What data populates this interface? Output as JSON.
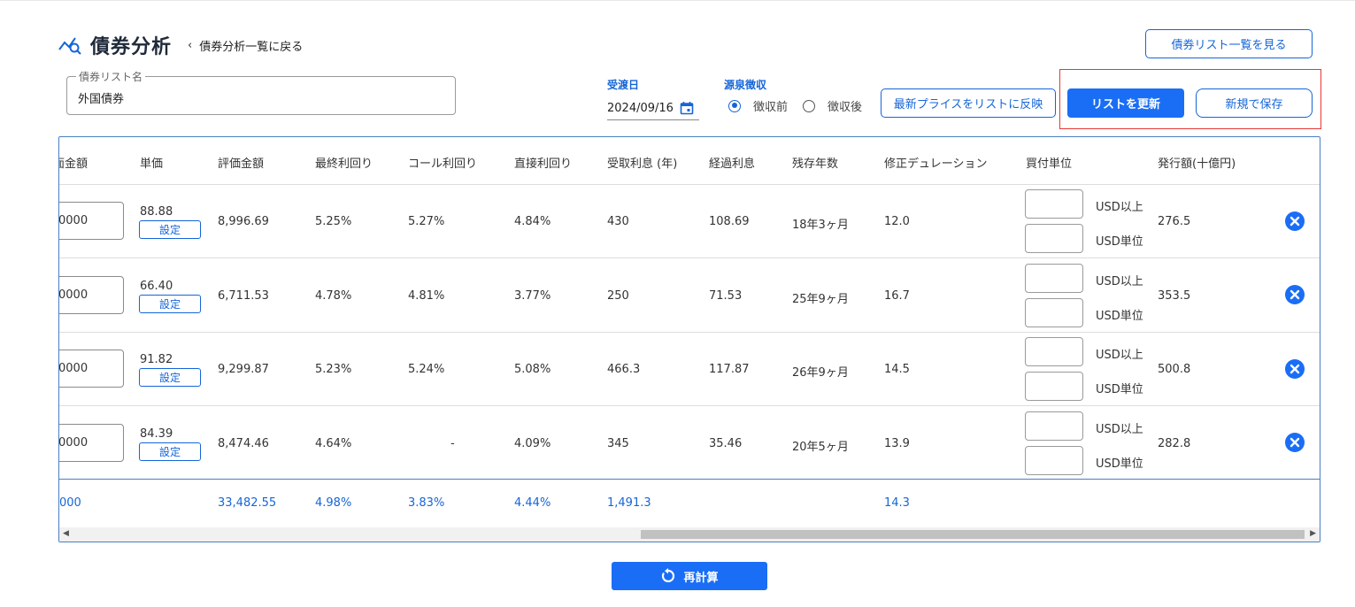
{
  "header": {
    "title": "債券分析",
    "back_link": "債券分析一覧に戻る",
    "view_list_button": "債券リスト一覧を見る"
  },
  "form": {
    "list_name_label": "債券リスト名",
    "list_name_value": "外国債券",
    "settlement_label": "受渡日",
    "settlement_date": "2024/09/16",
    "withholding_label": "源泉徴収",
    "withholding_options": [
      "徴収前",
      "徴収後"
    ],
    "withholding_selected": "徴収前",
    "reflect_price_button": "最新プライスをリストに反映",
    "update_list_button": "リストを更新",
    "save_new_button": "新規で保存"
  },
  "table": {
    "headers": [
      "面金額",
      "単価",
      "評価金額",
      "最終利回り",
      "コール利回り",
      "直接利回り",
      "受取利息 (年)",
      "経過利息",
      "残存年数",
      "修正デュレーション",
      "買付単位",
      "発行額(十億円)"
    ],
    "set_label": "設定",
    "unit_labels": [
      "USD以上",
      "USD単位"
    ],
    "rows": [
      {
        "face": "0000",
        "price": "88.88",
        "valuation": "8,996.69",
        "ytm": "5.25%",
        "ytc": "5.27%",
        "current_yield": "4.84%",
        "annual_interest": "430",
        "accrued": "108.69",
        "remaining": "18年3ヶ月",
        "mod_duration": "12.0",
        "issue": "276.5"
      },
      {
        "face": "0000",
        "price": "66.40",
        "valuation": "6,711.53",
        "ytm": "4.78%",
        "ytc": "4.81%",
        "current_yield": "3.77%",
        "annual_interest": "250",
        "accrued": "71.53",
        "remaining": "25年9ヶ月",
        "mod_duration": "16.7",
        "issue": "353.5"
      },
      {
        "face": "0000",
        "price": "91.82",
        "valuation": "9,299.87",
        "ytm": "5.23%",
        "ytc": "5.24%",
        "current_yield": "5.08%",
        "annual_interest": "466.3",
        "accrued": "117.87",
        "remaining": "26年9ヶ月",
        "mod_duration": "14.5",
        "issue": "500.8"
      },
      {
        "face": "0000",
        "price": "84.39",
        "valuation": "8,474.46",
        "ytm": "4.64%",
        "ytc": "-",
        "current_yield": "4.09%",
        "annual_interest": "345",
        "accrued": "35.46",
        "remaining": "20年5ヶ月",
        "mod_duration": "13.9",
        "issue": "282.8"
      }
    ],
    "totals": {
      "face": "000",
      "valuation": "33,482.55",
      "ytm": "4.98%",
      "ytc": "3.83%",
      "current_yield": "4.44%",
      "annual_interest": "1,491.3",
      "mod_duration": "14.3"
    }
  },
  "footer": {
    "recalc_button": "再計算"
  },
  "colors": {
    "accent": "#1a6ef5",
    "highlight_border": "#e53935"
  }
}
